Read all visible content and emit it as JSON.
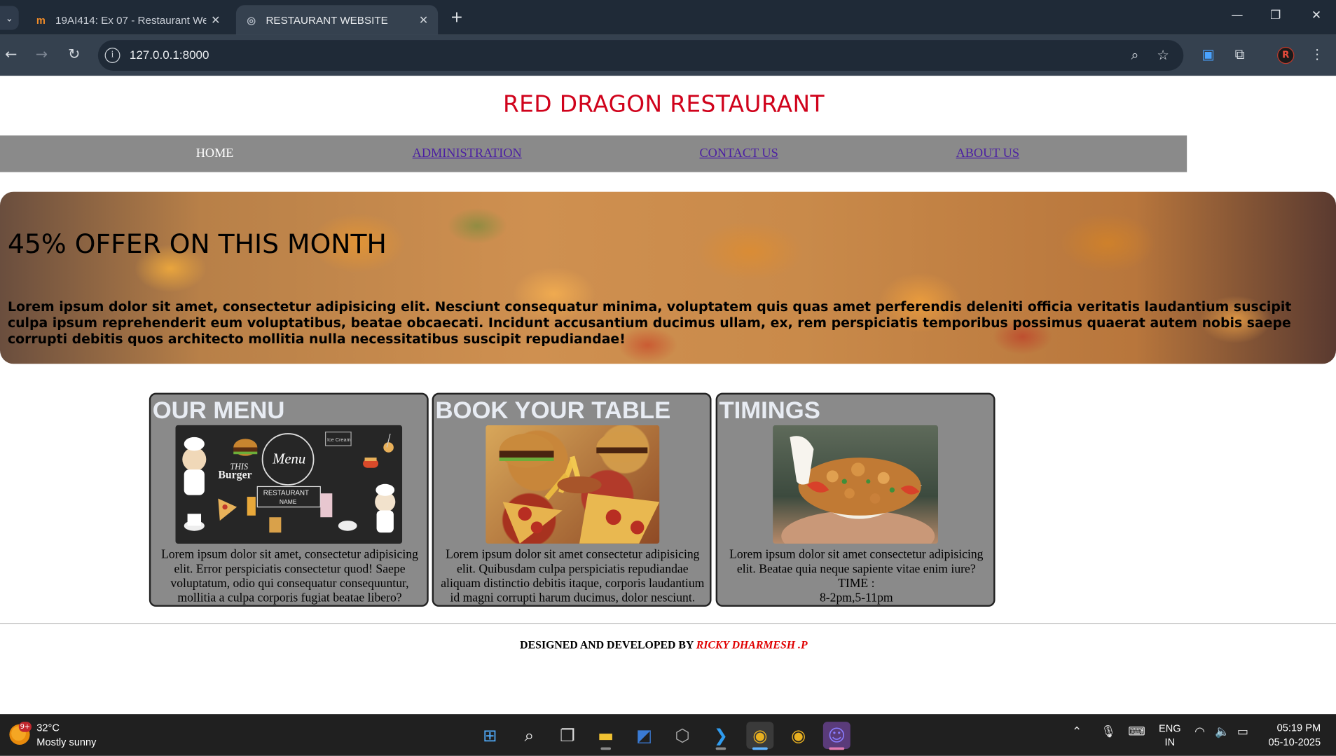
{
  "browser": {
    "tabs": [
      {
        "title": "19AI414: Ex 07 - Restaurant We",
        "favicon": "moodle-icon"
      },
      {
        "title": "RESTAURANT WEBSITE",
        "favicon": "globe-icon"
      }
    ],
    "url": "127.0.0.1:8000",
    "profile_initial": "R"
  },
  "site": {
    "title": "RED DRAGON RESTAURANT",
    "nav": [
      "HOME",
      "ADMINISTRATION",
      "CONTACT US",
      "ABOUT US"
    ]
  },
  "hero": {
    "heading": "45% OFFER ON THIS MONTH",
    "text": "Lorem ipsum dolor sit amet, consectetur adipisicing elit. Nesciunt consequatur minima, voluptatem quis quas amet perferendis deleniti officia veritatis laudantium suscipit culpa ipsum reprehenderit eum voluptatibus, beatae obcaecati. Incidunt accusantium ducimus ullam, ex, rem perspiciatis temporibus possimus quaerat autem nobis saepe corrupti debitis quos architecto mollitia nulla necessitatibus suscipit repudiandae!"
  },
  "cards": [
    {
      "title": "OUR MENU",
      "text": "Lorem ipsum dolor sit amet, consectetur adipisicing elit. Error perspiciatis consectetur quod! Saepe voluptatum, odio qui consequatur consequuntur, mollitia a culpa corporis fugiat beatae libero?",
      "menu_board": {
        "t1": "THIS",
        "t2": "Burger",
        "t3": "Menu",
        "t4": "RESTAURANT",
        "t5": "NAME",
        "t6": "Ice Cream"
      }
    },
    {
      "title": "BOOK YOUR TABLE",
      "text": "Lorem ipsum dolor sit amet consectetur adipisicing elit. Quibusdam culpa perspiciatis repudiandae aliquam distinctio debitis itaque, corporis laudantium id magni corrupti harum ducimus, dolor nesciunt."
    },
    {
      "title": "TIMINGS",
      "text": "Lorem ipsum dolor sit amet consectetur adipisicing elit. Beatae quia neque sapiente vitae enim iure?",
      "time_label": "TIME :",
      "time_value": "8-2pm,5-11pm"
    }
  ],
  "footer": {
    "prefix": "DESIGNED AND DEVELOPED BY",
    "developer": "RICKY DHARMESH .P"
  },
  "taskbar": {
    "weather_temp": "32°C",
    "weather_desc": "Mostly sunny",
    "weather_badge": "9+",
    "lang_1": "ENG",
    "lang_2": "IN",
    "time": "05:19 PM",
    "date": "05-10-2025"
  }
}
